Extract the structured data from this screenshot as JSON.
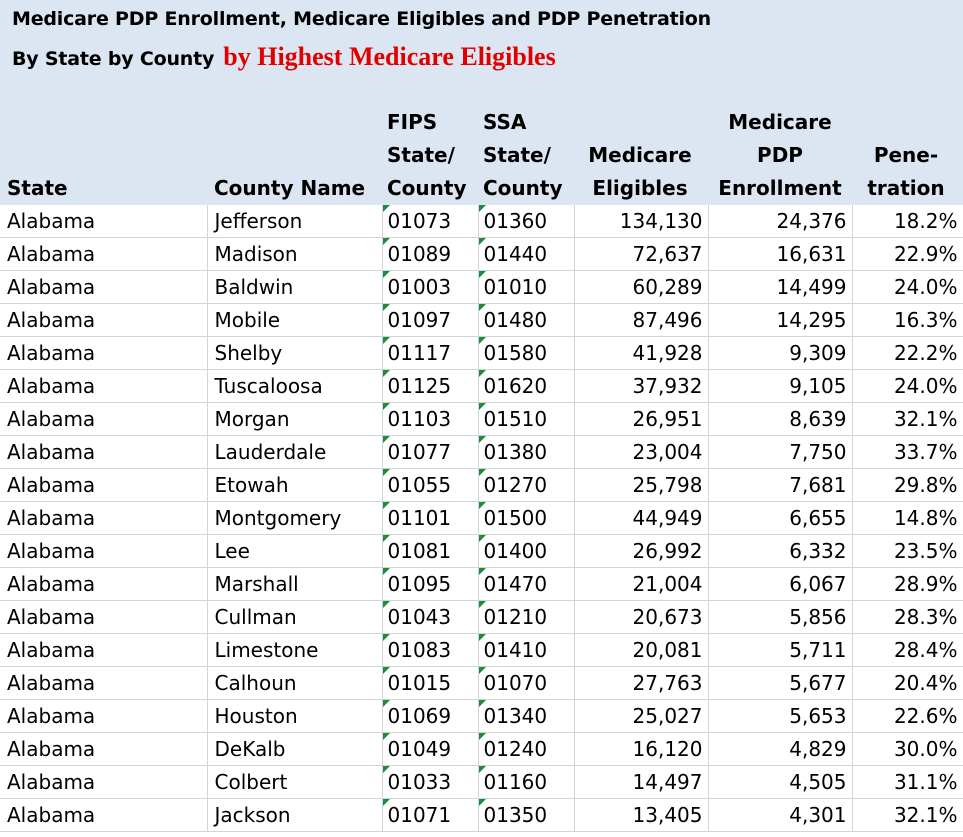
{
  "title": {
    "line1": "Medicare PDP Enrollment, Medicare Eligibles and PDP Penetration",
    "line2_black": "By State by County",
    "line2_red": "by Highest Medicare Eligibles"
  },
  "colors": {
    "header_bg": "#dce6f2",
    "accent_red": "#e00000",
    "flag_green": "#1e8c3a"
  },
  "headers": {
    "state": "State",
    "county": "County Name",
    "fips": [
      "FIPS",
      "State/",
      "County"
    ],
    "ssa": [
      "SSA",
      "State/",
      "County"
    ],
    "eligibles": [
      "Medicare",
      "Eligibles"
    ],
    "enrollment": [
      "Medicare",
      "PDP",
      "Enrollment"
    ],
    "penetration": [
      "Pene-",
      "tration"
    ]
  },
  "rows": [
    {
      "state": "Alabama",
      "county": "Jefferson",
      "fips": "01073",
      "ssa": "01360",
      "eligibles": "134,130",
      "enrollment": "24,376",
      "penetration": "18.2%"
    },
    {
      "state": "Alabama",
      "county": "Madison",
      "fips": "01089",
      "ssa": "01440",
      "eligibles": "72,637",
      "enrollment": "16,631",
      "penetration": "22.9%"
    },
    {
      "state": "Alabama",
      "county": "Baldwin",
      "fips": "01003",
      "ssa": "01010",
      "eligibles": "60,289",
      "enrollment": "14,499",
      "penetration": "24.0%"
    },
    {
      "state": "Alabama",
      "county": "Mobile",
      "fips": "01097",
      "ssa": "01480",
      "eligibles": "87,496",
      "enrollment": "14,295",
      "penetration": "16.3%"
    },
    {
      "state": "Alabama",
      "county": "Shelby",
      "fips": "01117",
      "ssa": "01580",
      "eligibles": "41,928",
      "enrollment": "9,309",
      "penetration": "22.2%"
    },
    {
      "state": "Alabama",
      "county": "Tuscaloosa",
      "fips": "01125",
      "ssa": "01620",
      "eligibles": "37,932",
      "enrollment": "9,105",
      "penetration": "24.0%"
    },
    {
      "state": "Alabama",
      "county": "Morgan",
      "fips": "01103",
      "ssa": "01510",
      "eligibles": "26,951",
      "enrollment": "8,639",
      "penetration": "32.1%"
    },
    {
      "state": "Alabama",
      "county": "Lauderdale",
      "fips": "01077",
      "ssa": "01380",
      "eligibles": "23,004",
      "enrollment": "7,750",
      "penetration": "33.7%"
    },
    {
      "state": "Alabama",
      "county": "Etowah",
      "fips": "01055",
      "ssa": "01270",
      "eligibles": "25,798",
      "enrollment": "7,681",
      "penetration": "29.8%"
    },
    {
      "state": "Alabama",
      "county": "Montgomery",
      "fips": "01101",
      "ssa": "01500",
      "eligibles": "44,949",
      "enrollment": "6,655",
      "penetration": "14.8%"
    },
    {
      "state": "Alabama",
      "county": "Lee",
      "fips": "01081",
      "ssa": "01400",
      "eligibles": "26,992",
      "enrollment": "6,332",
      "penetration": "23.5%"
    },
    {
      "state": "Alabama",
      "county": "Marshall",
      "fips": "01095",
      "ssa": "01470",
      "eligibles": "21,004",
      "enrollment": "6,067",
      "penetration": "28.9%"
    },
    {
      "state": "Alabama",
      "county": "Cullman",
      "fips": "01043",
      "ssa": "01210",
      "eligibles": "20,673",
      "enrollment": "5,856",
      "penetration": "28.3%"
    },
    {
      "state": "Alabama",
      "county": "Limestone",
      "fips": "01083",
      "ssa": "01410",
      "eligibles": "20,081",
      "enrollment": "5,711",
      "penetration": "28.4%"
    },
    {
      "state": "Alabama",
      "county": "Calhoun",
      "fips": "01015",
      "ssa": "01070",
      "eligibles": "27,763",
      "enrollment": "5,677",
      "penetration": "20.4%"
    },
    {
      "state": "Alabama",
      "county": "Houston",
      "fips": "01069",
      "ssa": "01340",
      "eligibles": "25,027",
      "enrollment": "5,653",
      "penetration": "22.6%"
    },
    {
      "state": "Alabama",
      "county": "DeKalb",
      "fips": "01049",
      "ssa": "01240",
      "eligibles": "16,120",
      "enrollment": "4,829",
      "penetration": "30.0%"
    },
    {
      "state": "Alabama",
      "county": "Colbert",
      "fips": "01033",
      "ssa": "01160",
      "eligibles": "14,497",
      "enrollment": "4,505",
      "penetration": "31.1%"
    },
    {
      "state": "Alabama",
      "county": "Jackson",
      "fips": "01071",
      "ssa": "01350",
      "eligibles": "13,405",
      "enrollment": "4,301",
      "penetration": "32.1%"
    }
  ]
}
